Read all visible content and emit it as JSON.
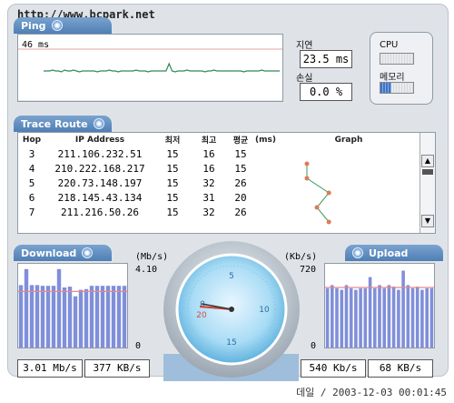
{
  "watermark": "http://www.bcpark.net",
  "ping": {
    "tab_label": "Ping",
    "current": "46 ms",
    "latency_label": "지연",
    "latency_value": "23.5 ms",
    "loss_label": "손실",
    "loss_value": "0.0 %",
    "trace": [
      28,
      28,
      28,
      27,
      28,
      28,
      29,
      27,
      28,
      28,
      27,
      28,
      29,
      28,
      28,
      28,
      28,
      28,
      29,
      28,
      28,
      28,
      27,
      28,
      28,
      29,
      28,
      28,
      28,
      28,
      28,
      27,
      28,
      28,
      28,
      29,
      28,
      28,
      28,
      28,
      28,
      28,
      20,
      28,
      29,
      28,
      28,
      28,
      27,
      28,
      28,
      28,
      28,
      28,
      29,
      28,
      28,
      27,
      28,
      28,
      28,
      28,
      28,
      28,
      28,
      28,
      28,
      29,
      28,
      28,
      28,
      28,
      28,
      27,
      28,
      28,
      28,
      28,
      28,
      28
    ]
  },
  "system": {
    "cpu_label": "CPU",
    "memory_label": "메모리",
    "cpu_level": 0.0,
    "memory_level": 0.32
  },
  "trace_route": {
    "tab_label": "Trace Route",
    "columns": [
      "Hop",
      "IP Address",
      "최저",
      "최고",
      "평균",
      "(ms)",
      "Graph"
    ],
    "rows": [
      {
        "hop": "3",
        "ip": "211.106.232.51",
        "min": "15",
        "max": "16",
        "avg": "15"
      },
      {
        "hop": "4",
        "ip": "210.222.168.217",
        "min": "15",
        "max": "16",
        "avg": "15"
      },
      {
        "hop": "5",
        "ip": "220.73.148.197",
        "min": "15",
        "max": "32",
        "avg": "26"
      },
      {
        "hop": "6",
        "ip": "218.145.43.134",
        "min": "15",
        "max": "31",
        "avg": "20"
      },
      {
        "hop": "7",
        "ip": "211.216.50.26",
        "min": "15",
        "max": "32",
        "avg": "26"
      }
    ],
    "scroll_up_icon": "▲",
    "scroll_down_icon": "▼"
  },
  "download": {
    "tab_label": "Download",
    "unit": "(Mb/s)",
    "max_label": "4.10",
    "zero_label": "0",
    "bars": [
      0.78,
      0.98,
      0.78,
      0.78,
      0.77,
      0.77,
      0.77,
      0.98,
      0.75,
      0.76,
      0.64,
      0.72,
      0.73,
      0.77,
      0.77,
      0.77,
      0.77,
      0.77,
      0.77,
      0.77
    ],
    "avg_level": 0.7,
    "rate_bits": "3.01 Mb/s",
    "rate_bytes": "377 KB/s"
  },
  "upload": {
    "tab_label": "Upload",
    "unit": "(Kb/s)",
    "max_label": "720",
    "zero_label": "0",
    "bars": [
      0.74,
      0.78,
      0.74,
      0.72,
      0.78,
      0.74,
      0.72,
      0.74,
      0.74,
      0.88,
      0.74,
      0.78,
      0.74,
      0.78,
      0.76,
      0.72,
      0.96,
      0.78,
      0.74,
      0.76,
      0.72,
      0.74,
      0.74
    ],
    "avg_level": 0.75,
    "rate_bits": "540 Kb/s",
    "rate_bytes": "68 KB/s"
  },
  "gauge": {
    "ticks": [
      "0",
      "5",
      "10",
      "15",
      "20"
    ]
  },
  "timestamp": "데일 / 2003-12-03 00:01:45"
}
